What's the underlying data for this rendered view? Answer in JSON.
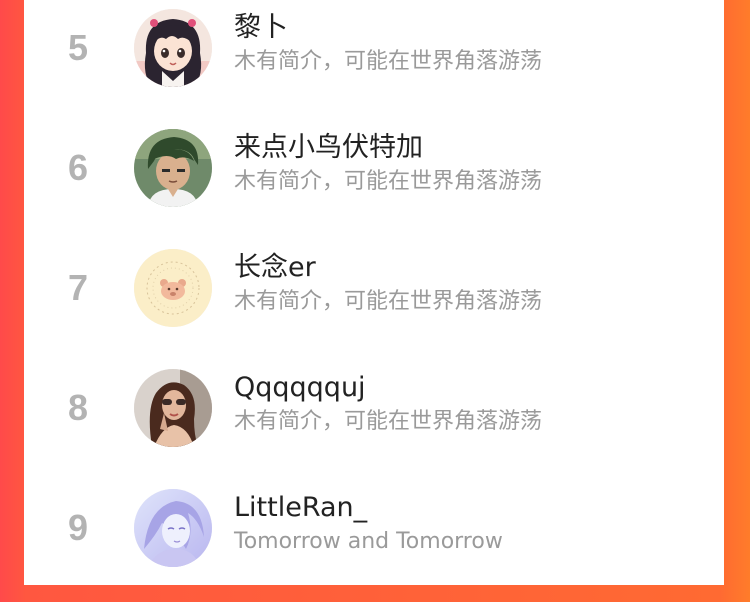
{
  "colors": {
    "background_left": "#ff4a4a",
    "background_right": "#ff7c2a",
    "panel": "#ffffff",
    "rank_text": "#b3b3b3",
    "name_text": "#222222",
    "bio_text": "#9a9a9a"
  },
  "ranking": {
    "rows": [
      {
        "rank": "5",
        "name": "黎卜",
        "bio": "木有简介，可能在世界角落游荡",
        "avatar_icon": "anime-girl-avatar"
      },
      {
        "rank": "6",
        "name": "来点小鸟伏特加",
        "bio": "木有简介，可能在世界角落游荡",
        "avatar_icon": "anime-boy-avatar"
      },
      {
        "rank": "7",
        "name": "长念er",
        "bio": "木有简介，可能在世界角落游荡",
        "avatar_icon": "bear-stamp-avatar"
      },
      {
        "rank": "8",
        "name": "Qqqqqquj",
        "bio": "木有简介，可能在世界角落游荡",
        "avatar_icon": "photo-woman-avatar"
      },
      {
        "rank": "9",
        "name": "LittleRan_",
        "bio": "Tomorrow and Tomorrow",
        "avatar_icon": "illustrated-girl-avatar"
      }
    ]
  }
}
